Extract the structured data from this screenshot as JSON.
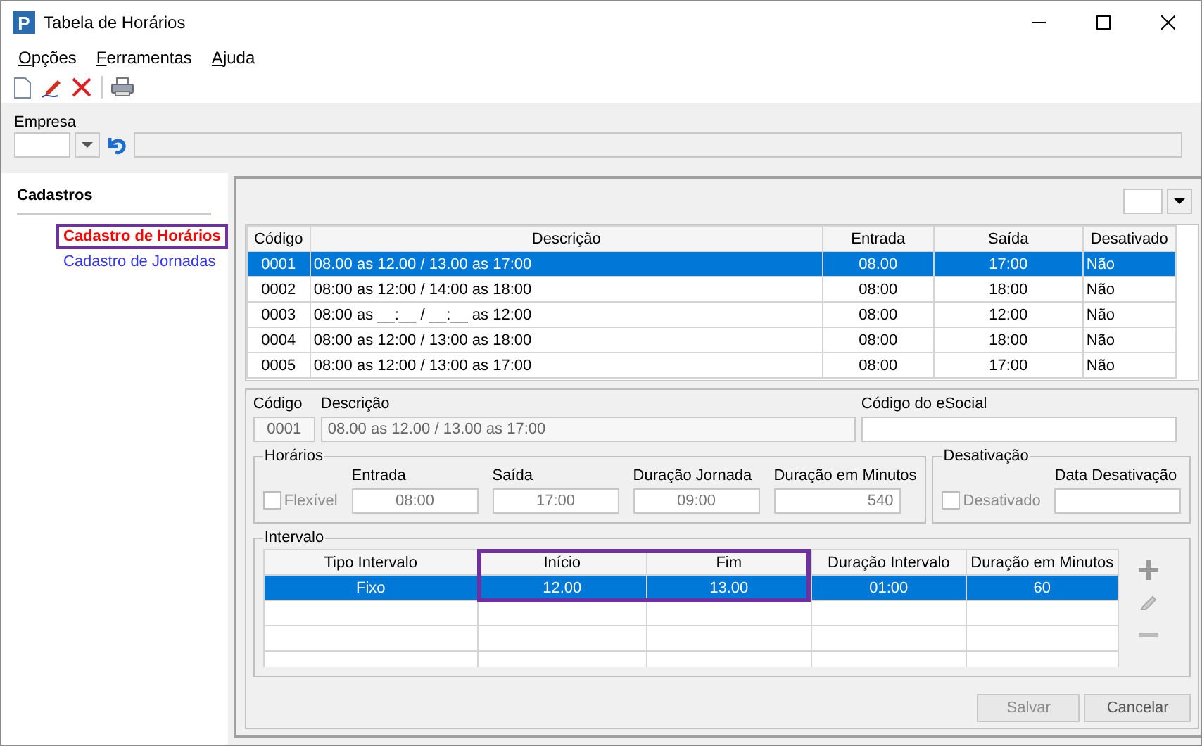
{
  "window": {
    "title": "Tabela de Horários",
    "app_icon": "P"
  },
  "menu": [
    "Opções",
    "Ferramentas",
    "Ajuda"
  ],
  "empresa": {
    "label": "Empresa"
  },
  "sidebar": {
    "title": "Cadastros",
    "items": [
      {
        "label": "Cadastro de Horários",
        "selected": true,
        "highlighted": true
      },
      {
        "label": "Cadastro de Jornadas",
        "selected": false,
        "highlighted": false
      }
    ]
  },
  "table": {
    "columns": [
      "Código",
      "Descrição",
      "Entrada",
      "Saída",
      "Desativado"
    ],
    "rows": [
      {
        "cells": [
          "0001",
          "08.00 as 12.00 / 13.00 as 17:00",
          "08.00",
          "17:00",
          "Não"
        ],
        "selected": true
      },
      {
        "cells": [
          "0002",
          "08:00 as 12:00 / 14:00 as 18:00",
          "08:00",
          "18:00",
          "Não"
        ],
        "selected": false
      },
      {
        "cells": [
          "0003",
          "08:00 as __:__ / __:__ as 12:00",
          "08:00",
          "12:00",
          "Não"
        ],
        "selected": false
      },
      {
        "cells": [
          "0004",
          "08:00 as 12:00 / 13:00 as 18:00",
          "08:00",
          "18:00",
          "Não"
        ],
        "selected": false
      },
      {
        "cells": [
          "0005",
          "08:00 as 12:00 / 13:00 as 17:00",
          "08:00",
          "17:00",
          "Não"
        ],
        "selected": false
      }
    ]
  },
  "form": {
    "codigo": {
      "label": "Código",
      "value": "0001"
    },
    "descricao": {
      "label": "Descrição",
      "value": "08.00 as 12.00 / 13.00 as 17:00"
    },
    "esocial": {
      "label": "Código do eSocial"
    },
    "horarios": {
      "title": "Horários",
      "flexivel": {
        "label": "Flexível",
        "checked": false,
        "disabled": true
      },
      "fields": [
        {
          "label": "Entrada",
          "value": "08:00"
        },
        {
          "label": "Saída",
          "value": "17:00"
        },
        {
          "label": "Duração Jornada",
          "value": "09:00"
        },
        {
          "label": "Duração em Minutos",
          "value": "540"
        }
      ]
    },
    "desativacao": {
      "title": "Desativação",
      "desativado": {
        "label": "Desativado",
        "checked": false,
        "disabled": true
      },
      "data": {
        "label": "Data Desativação"
      }
    },
    "intervalo": {
      "title": "Intervalo",
      "columns": [
        {
          "label": "Tipo Intervalo",
          "highlighted": false
        },
        {
          "label": "Início",
          "highlighted": true
        },
        {
          "label": "Fim",
          "highlighted": true
        },
        {
          "label": "Duração Intervalo",
          "highlighted": false
        },
        {
          "label": "Duração em Minutos",
          "highlighted": false
        }
      ],
      "rows": [
        {
          "cells": [
            "Fixo",
            "12.00",
            "13.00",
            "01:00",
            "60"
          ],
          "selected": true
        }
      ]
    },
    "buttons": [
      {
        "label": "Salvar",
        "disabled": true
      },
      {
        "label": "Cancelar",
        "disabled": false
      }
    ]
  }
}
